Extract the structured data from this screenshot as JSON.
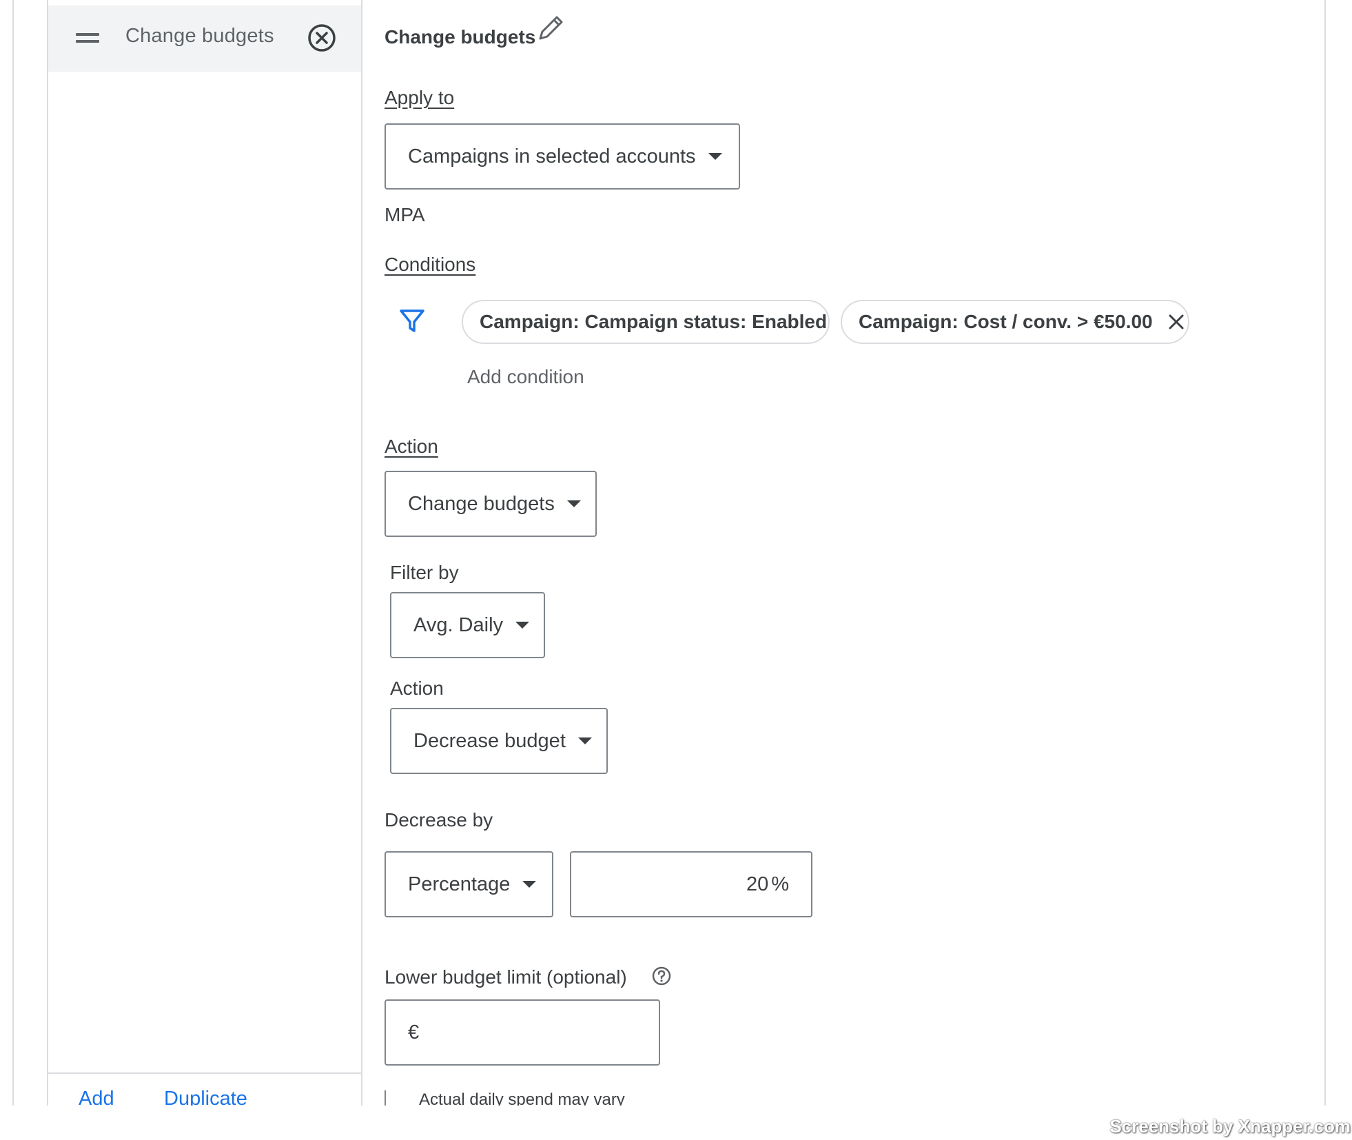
{
  "sidebar": {
    "selected_item_label": "Change budgets",
    "add_label": "Add",
    "duplicate_label": "Duplicate"
  },
  "rule": {
    "title": "Change budgets",
    "apply_to_label": "Apply to",
    "apply_to_value": "Campaigns in selected accounts",
    "account": "MPA",
    "conditions_label": "Conditions",
    "conditions": [
      "Campaign: Campaign status: Enabled",
      "Campaign: Cost / conv. > €50.00"
    ],
    "add_condition_label": "Add condition",
    "action_label": "Action",
    "action_value": "Change budgets",
    "filter_by_label": "Filter by",
    "filter_by_value": "Avg. Daily",
    "sub_action_label": "Action",
    "sub_action_value": "Decrease budget",
    "decrease_by_label": "Decrease by",
    "decrease_type_value": "Percentage",
    "decrease_amount_value": "20",
    "decrease_amount_unit": "%",
    "lower_limit_label": "Lower budget limit (optional)",
    "currency_symbol": "€",
    "spend_note": "Actual daily spend may vary"
  },
  "watermark": "Screenshot by Xnapper.com",
  "colors": {
    "accent": "#1a73e8",
    "border": "#80868b",
    "divider": "#dadce0",
    "selected_bg": "#f1f3f4"
  }
}
